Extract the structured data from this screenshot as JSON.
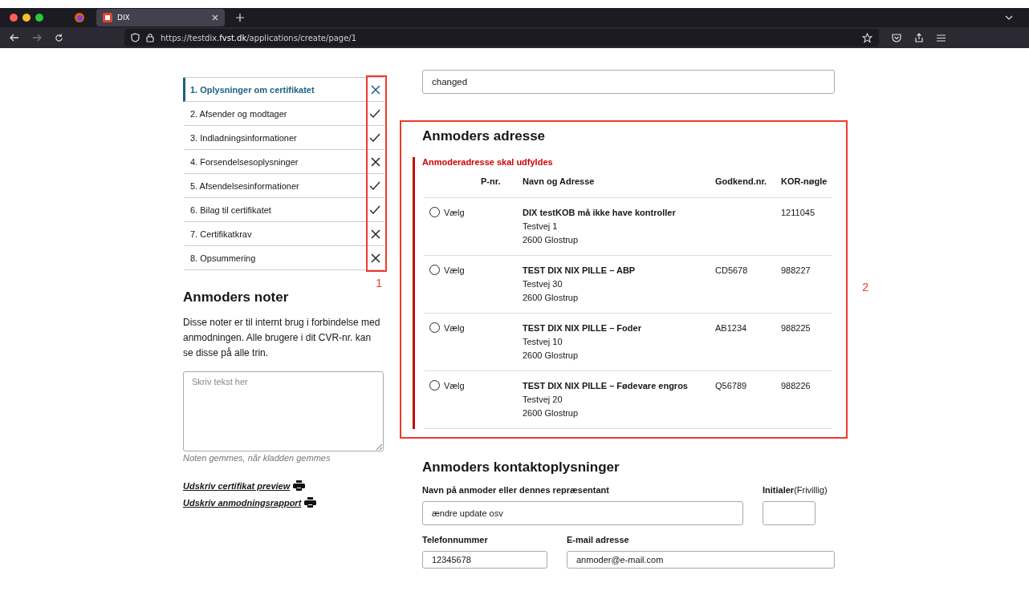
{
  "browser": {
    "tab_title": "DIX",
    "url_prefix": "https://testdix.",
    "url_domain": "fvst.dk",
    "url_path": "/applications/create/page/1"
  },
  "steps": [
    {
      "label": "1. Oplysninger om certifikatet",
      "selected": true,
      "complete": false
    },
    {
      "label": "2. Afsender og modtager",
      "selected": false,
      "complete": true
    },
    {
      "label": "3. Indladningsinformationer",
      "selected": false,
      "complete": true
    },
    {
      "label": "4. Forsendelsesoplysninger",
      "selected": false,
      "complete": false
    },
    {
      "label": "5. Afsendelsesinformationer",
      "selected": false,
      "complete": true
    },
    {
      "label": "6. Bilag til certifikatet",
      "selected": false,
      "complete": true
    },
    {
      "label": "7. Certifikatkrav",
      "selected": false,
      "complete": false
    },
    {
      "label": "8. Opsummering",
      "selected": false,
      "complete": false
    }
  ],
  "annotations": [
    "1",
    "2"
  ],
  "notes": {
    "title": "Anmoders noter",
    "description": "Disse noter er til internt brug i forbindelse med anmodningen. Alle brugere i dit CVR-nr. kan se disse på alle trin.",
    "placeholder": "Skriv tekst her",
    "hint": "Noten gemmes, når kladden gemmes"
  },
  "print_links": [
    "Udskriv certifikat preview",
    "Udskriv anmodningsrapport"
  ],
  "reference_field": {
    "value": "changed"
  },
  "address": {
    "title": "Anmoders adresse",
    "error": "Anmoderadresse skal udfyldes",
    "columns": [
      "P-nr.",
      "Navn og Adresse",
      "Godkend.nr.",
      "KOR-nøgle"
    ],
    "rows": [
      {
        "radio_label": "Vælg",
        "selected": false,
        "p_nr": "",
        "name": "DIX testKOB må ikke have kontroller",
        "street": "Testvej 1",
        "city": "2600 Glostrup",
        "approval": "",
        "kor": "1211045"
      },
      {
        "radio_label": "Vælg",
        "selected": false,
        "p_nr": "",
        "name": "TEST DIX NIX PILLE – ABP",
        "street": "Testvej 30",
        "city": "2600 Glostrup",
        "approval": "CD5678",
        "kor": "988227"
      },
      {
        "radio_label": "Vælg",
        "selected": false,
        "p_nr": "",
        "name": "TEST DIX NIX PILLE – Foder",
        "street": "Testvej 10",
        "city": "2600 Glostrup",
        "approval": "AB1234",
        "kor": "988225"
      },
      {
        "radio_label": "Vælg",
        "selected": false,
        "p_nr": "",
        "name": "TEST DIX NIX PILLE – Fødevare engros",
        "street": "Testvej 20",
        "city": "2600 Glostrup",
        "approval": "Q56789",
        "kor": "988226"
      }
    ]
  },
  "contact": {
    "title": "Anmoders kontaktoplysninger",
    "name_label": "Navn på anmoder eller dennes repræsentant",
    "name_value": "ændre update osv",
    "initials_label": "Initialer",
    "initials_optional": "(Frivillig)",
    "phone_label": "Telefonnummer",
    "phone_value": "12345678",
    "email_label": "E-mail adresse",
    "email_value": "anmoder@e-mail.com"
  }
}
